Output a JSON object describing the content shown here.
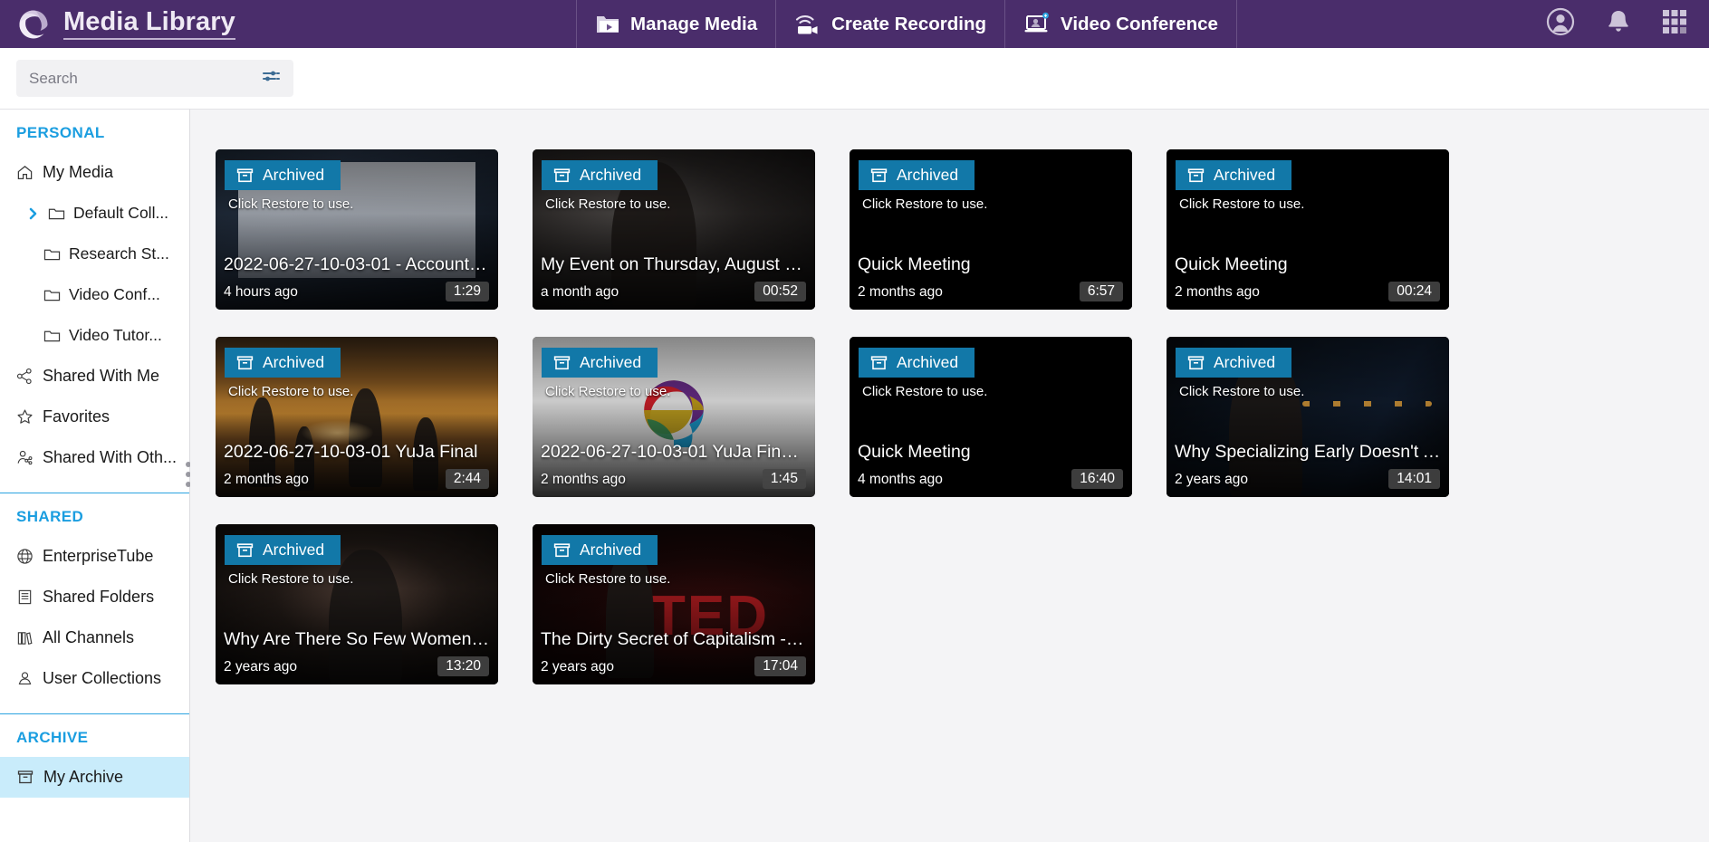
{
  "header": {
    "brand_title": "Media Library",
    "logo_icon": "swirl-logo-icon",
    "nav": [
      {
        "label": "Manage Media",
        "icon": "folder-play-icon"
      },
      {
        "label": "Create Recording",
        "icon": "wifi-camcorder-icon"
      },
      {
        "label": "Video Conference",
        "icon": "laptop-person-icon"
      }
    ],
    "actions": [
      {
        "name": "account-icon",
        "label": "Account"
      },
      {
        "name": "notifications-bell-icon",
        "label": "Notifications"
      },
      {
        "name": "apps-grid-icon",
        "label": "Apps"
      }
    ]
  },
  "search": {
    "placeholder": "Search",
    "value": "",
    "filter_icon": "filter-sliders-icon"
  },
  "sidebar": {
    "sections": [
      {
        "heading": "PERSONAL",
        "items": [
          {
            "label": "My Media",
            "icon": "home-icon",
            "level": 0,
            "expandable": false,
            "active": false
          },
          {
            "label": "Default Coll...",
            "icon": "folder-icon",
            "level": 1,
            "expandable": true,
            "active": false
          },
          {
            "label": "Research St...",
            "icon": "folder-icon",
            "level": 1,
            "expandable": false,
            "active": false
          },
          {
            "label": "Video Conf...",
            "icon": "folder-icon",
            "level": 1,
            "expandable": false,
            "active": false
          },
          {
            "label": "Video Tutor...",
            "icon": "folder-icon",
            "level": 1,
            "expandable": false,
            "active": false
          },
          {
            "label": "Shared With Me",
            "icon": "share-nodes-icon",
            "level": 0,
            "expandable": false,
            "active": false
          },
          {
            "label": "Favorites",
            "icon": "star-icon",
            "level": 0,
            "expandable": false,
            "active": false
          },
          {
            "label": "Shared With Oth...",
            "icon": "person-share-icon",
            "level": 0,
            "expandable": false,
            "active": false
          }
        ]
      },
      {
        "heading": "SHARED",
        "items": [
          {
            "label": "EnterpriseTube",
            "icon": "globe-icon",
            "level": 0,
            "expandable": false,
            "active": false
          },
          {
            "label": "Shared Folders",
            "icon": "building-icon",
            "level": 0,
            "expandable": false,
            "active": false
          },
          {
            "label": "All Channels",
            "icon": "books-icon",
            "level": 0,
            "expandable": false,
            "active": false
          },
          {
            "label": "User Collections",
            "icon": "user-collection-icon",
            "level": 0,
            "expandable": false,
            "active": false
          }
        ]
      },
      {
        "heading": "ARCHIVE",
        "items": [
          {
            "label": "My Archive",
            "icon": "archive-box-icon",
            "level": 0,
            "expandable": false,
            "active": true
          }
        ]
      }
    ],
    "resize_handle": "sidebar-resize-handle"
  },
  "media": {
    "badge_label": "Archived",
    "restore_hint": "Click Restore to use.",
    "badge_icon": "archive-box-icon",
    "accent_color": "#1278a8",
    "items": [
      {
        "title": "2022-06-27-10-03-01 - Accountin...",
        "when": "4 hours ago",
        "duration": "1:29",
        "thumb": "th-meeting"
      },
      {
        "title": "My Event on Thursday, August 2...",
        "when": "a month ago",
        "duration": "00:52",
        "thumb": "th-dark-person"
      },
      {
        "title": "Quick Meeting",
        "when": "2 months ago",
        "duration": "6:57",
        "thumb": "th-black"
      },
      {
        "title": "Quick Meeting",
        "when": "2 months ago",
        "duration": "00:24",
        "thumb": "th-black"
      },
      {
        "title": "2022-06-27-10-03-01 YuJa Final",
        "when": "2 months ago",
        "duration": "2:44",
        "thumb": "th-sunset"
      },
      {
        "title": "2022-06-27-10-03-01 YuJa Final-e...",
        "when": "2 months ago",
        "duration": "1:45",
        "thumb": "th-swirl"
      },
      {
        "title": "Quick Meeting",
        "when": "4 months ago",
        "duration": "16:40",
        "thumb": "th-black"
      },
      {
        "title": "Why Specializing Early Doesn't A...",
        "when": "2 years ago",
        "duration": "14:01",
        "thumb": "th-stage-blue"
      },
      {
        "title": "Why Are There So Few Women ...",
        "when": "2 years ago",
        "duration": "13:20",
        "thumb": "th-ted-woman"
      },
      {
        "title": "The Dirty Secret of Capitalism -- ...",
        "when": "2 years ago",
        "duration": "17:04",
        "thumb": "th-ted-red"
      }
    ]
  },
  "colors": {
    "header_purple": "#4a2d6b",
    "accent_blue": "#1b9ee0",
    "badge_blue": "#1278a8",
    "active_row": "#c9ecfb",
    "canvas": "#f4f4f6"
  }
}
